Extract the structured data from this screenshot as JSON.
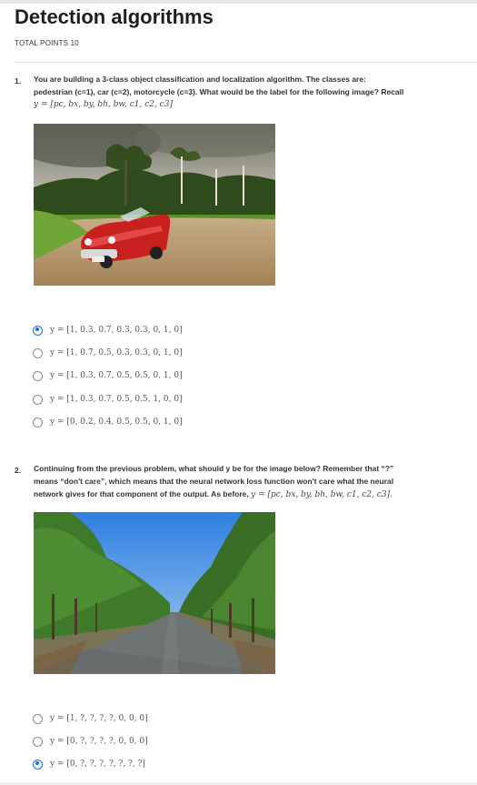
{
  "page": {
    "title": "Detection algorithms",
    "total_points": "TOTAL POINTS 10"
  },
  "questions": [
    {
      "number": "1.",
      "lines": [
        "You are building a 3-class object classification and localization algorithm. The classes are:",
        "pedestrian (c=1), car (c=2), motorcycle (c=3). What would be the label for the following image? Recall"
      ],
      "formula": "y = [pc, bx, by, bh, bw, c1, c2, c3]",
      "image": "red-vintage-car-on-dirt-road-photo",
      "options": [
        {
          "label": "y = [1, 0.3, 0.7, 0.3, 0.3, 0, 1, 0]",
          "selected": true
        },
        {
          "label": "y = [1, 0.7, 0.5, 0.3, 0.3, 0, 1, 0]",
          "selected": false
        },
        {
          "label": "y = [1, 0.3, 0.7, 0.5, 0.5, 0, 1, 0]",
          "selected": false
        },
        {
          "label": "y = [1, 0.3, 0.7, 0.5, 0.5, 1, 0, 0]",
          "selected": false
        },
        {
          "label": "y = [0, 0.2, 0.4, 0.5, 0.5, 0, 1, 0]",
          "selected": false
        }
      ]
    },
    {
      "number": "2.",
      "lines": [
        "Continuing from the previous problem, what should y be for the image below? Remember that “?”",
        "means “don't care”, which means that the neural network loss function won't care what the neural"
      ],
      "line3": "network gives for that component of the output. As before,",
      "formula": "y = [pc, bx, by, bh, bw, c1, c2, c3].",
      "image": "tree-lined-road-photo",
      "options": [
        {
          "label": "y = [1, ?, ?, ?, ?, 0, 0, 0]",
          "selected": false
        },
        {
          "label": "y = [0, ?, ?, ?, ?, 0, 0, 0]",
          "selected": false
        },
        {
          "label": "y = [0, ?, ?, ?, ?, ?, ?, ?]",
          "selected": true
        }
      ]
    }
  ],
  "colors": {
    "accent": "#1f6dd3",
    "radio_border": "#8a8a8a",
    "text": "#1f1f1f"
  }
}
